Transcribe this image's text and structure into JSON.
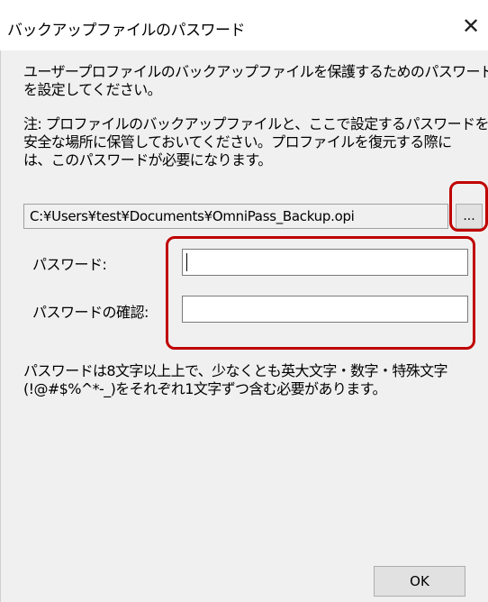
{
  "window": {
    "title": "バックアップファイルのパスワード",
    "close_glyph": "✕"
  },
  "description": [
    "ユーザープロファイルのバックアップファイルを保護するためのパスワード",
    "を設定してください。"
  ],
  "note": [
    "注: プロファイルのバックアップファイルと、ここで設定するパスワードを",
    "安全な場所に保管しておいてください。プロファイルを復元する際に",
    "は、このパスワードが必要になります。"
  ],
  "backup_path": {
    "value": "C:¥Users¥test¥Documents¥OmniPass_Backup.opi",
    "browse_label": "..."
  },
  "password": {
    "label": "パスワード:",
    "value": ""
  },
  "confirm": {
    "label": "パスワードの確認:",
    "value": ""
  },
  "requirements": [
    "パスワードは8文字以上上で、少なくとも英大文字・数字・特殊文字",
    "(!@#$%^*-_)をそれぞれ1文字ずつ含む必要があります。"
  ],
  "buttons": {
    "ok": "OK"
  },
  "colors": {
    "highlight": "#c00000",
    "dialog_bg": "#f0f0f0"
  }
}
